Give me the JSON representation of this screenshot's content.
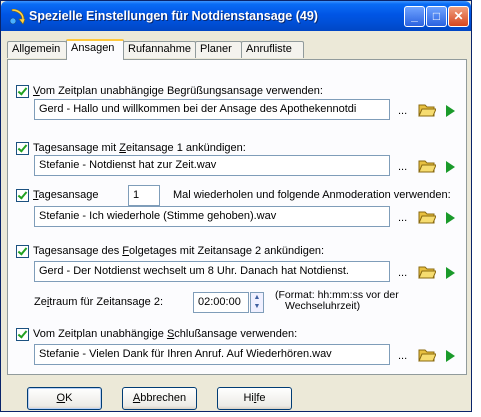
{
  "window": {
    "title": "Spezielle Einstellungen für Notdienstansage (49)"
  },
  "tabs": [
    {
      "label": "Allgemein"
    },
    {
      "label": "Ansagen"
    },
    {
      "label": "Rufannahme"
    },
    {
      "label": "Planer"
    },
    {
      "label": "Anrufliste"
    }
  ],
  "sections": {
    "greeting": {
      "checked": true,
      "label_prefix": "",
      "label_ul": "V",
      "label_rest": "om Zeitplan unabhängige Begrüßungsansage verwenden:",
      "file": "Gerd - Hallo und willkommen bei der Ansage des Apothekennotdi"
    },
    "today_time": {
      "checked": true,
      "label_prefix": "Tagesansage mit ",
      "label_ul": "Z",
      "label_rest": "eitansage 1 ankündigen:",
      "file": "Stefanie - Notdienst hat zur Zeit.wav"
    },
    "repeat": {
      "checked": true,
      "label_prefix": "",
      "label_ul": "T",
      "label_rest": "agesansage",
      "count": "1",
      "label_after": "Mal wiederholen und folgende Anmoderation verwenden:",
      "file": "Stefanie - Ich wiederhole (Stimme gehoben).wav"
    },
    "next_day": {
      "checked": true,
      "label_prefix": "Tagesansage des ",
      "label_ul": "F",
      "label_rest": "olgetages mit Zeitansage 2 ankündigen:",
      "file": "Gerd - Der Notdienst wechselt um 8 Uhr. Danach hat Notdienst.",
      "time_label_prefix": "Ze",
      "time_label_ul": "i",
      "time_label_rest": "traum für Zeitansage 2:",
      "time_value": "02:00:00",
      "format_line1": "(Format: hh:mm:ss vor der",
      "format_line2": "Wechseluhrzeit)"
    },
    "closing": {
      "checked": true,
      "label_prefix": "Vom Zeitplan unabhängige ",
      "label_ul": "S",
      "label_rest": "chlußansage verwenden:",
      "file": "Stefanie - Vielen Dank für Ihren Anruf. Auf Wiederhören.wav"
    }
  },
  "browse_label": "...",
  "buttons": {
    "ok_ul": "O",
    "ok_rest": "K",
    "cancel_ul": "A",
    "cancel_rest": "bbrechen",
    "help_prefix": "Hi",
    "help_ul": "l",
    "help_rest": "fe"
  },
  "colors": {
    "title_bar": "#0055e5",
    "play": "#1a9a2a",
    "folder": "#e8c040",
    "dialog_bg": "#ece9d8"
  },
  "icons": [
    "app-icon",
    "minimize-icon",
    "maximize-icon",
    "close-icon",
    "folder-icon",
    "play-icon",
    "spinner-up-icon",
    "spinner-down-icon"
  ]
}
